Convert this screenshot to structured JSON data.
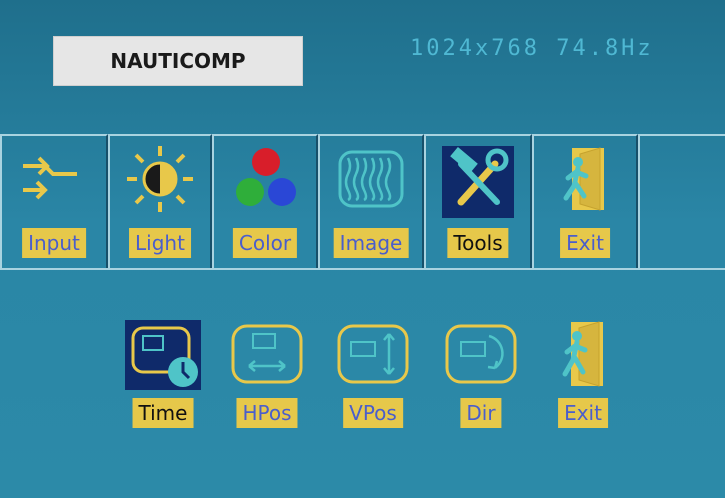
{
  "header": {
    "logo_text": "NAUTICOMP",
    "resolution": "1024x768 74.8Hz"
  },
  "tabs": [
    {
      "label": "Input",
      "icon": "input-arrows-icon"
    },
    {
      "label": "Light",
      "icon": "brightness-sun-icon"
    },
    {
      "label": "Color",
      "icon": "rgb-circles-icon"
    },
    {
      "label": "Image",
      "icon": "wave-image-icon"
    },
    {
      "label": "Tools",
      "icon": "tools-hammer-wrench-icon",
      "selected": true
    },
    {
      "label": "Exit",
      "icon": "exit-door-icon"
    }
  ],
  "sub_items": [
    {
      "label": "Time",
      "icon": "timer-clock-icon",
      "selected": true
    },
    {
      "label": "HPos",
      "icon": "horizontal-position-icon"
    },
    {
      "label": "VPos",
      "icon": "vertical-position-icon"
    },
    {
      "label": "Dir",
      "icon": "rotation-direction-icon"
    },
    {
      "label": "Exit",
      "icon": "exit-door-icon"
    }
  ],
  "colors": {
    "background": "#2a86a6",
    "label_bg": "#e6c84a",
    "label_text": "#4a5ecc",
    "selected_icon_bg": "#0f2a6a",
    "icon_cyan": "#4fc4c8"
  }
}
